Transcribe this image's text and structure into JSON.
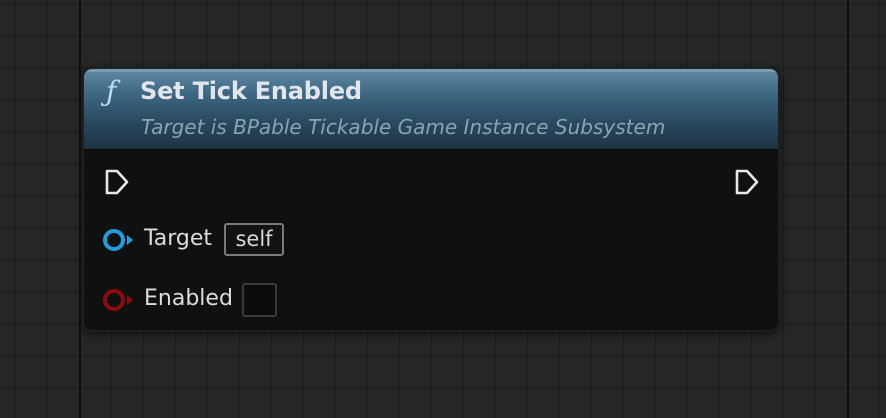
{
  "node": {
    "title": "Set Tick Enabled",
    "subtitle": "Target is BPable Tickable Game Instance Subsystem",
    "function_icon_glyph": "ƒ",
    "function_icon": "function-icon"
  },
  "pins": {
    "exec_in": "exec-input-pin",
    "exec_out": "exec-output-pin",
    "target": {
      "label": "Target",
      "default_value": "self",
      "color": "#1e9fe0"
    },
    "enabled": {
      "label": "Enabled",
      "checked": false,
      "color": "#8f0b0b"
    }
  },
  "colors": {
    "header_top": "#5f89a5",
    "header_bottom": "#1d3443",
    "node_body": "#0f1010",
    "grid_background": "#262626"
  }
}
